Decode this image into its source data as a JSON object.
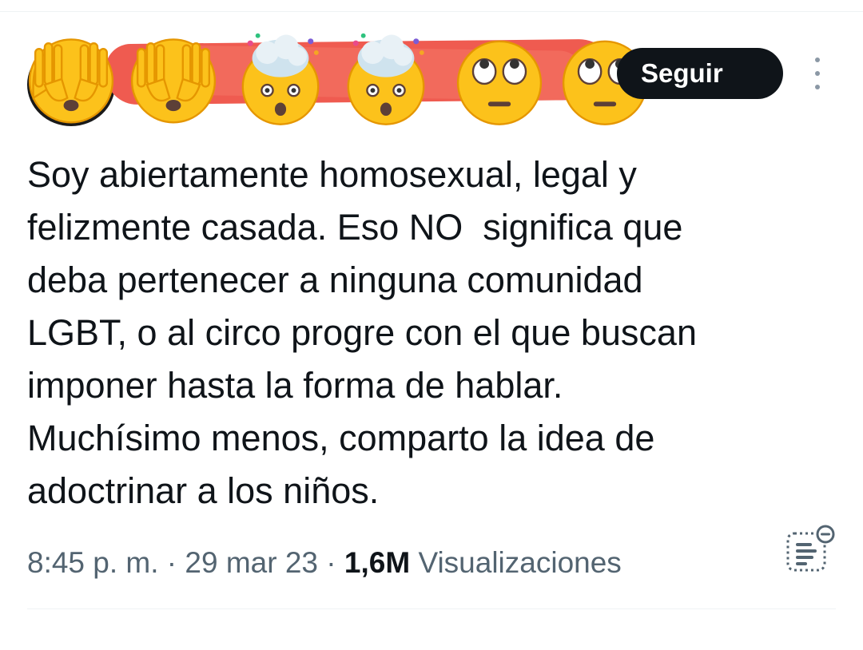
{
  "follow_button": {
    "label": "Seguir"
  },
  "tweet": {
    "text": "Soy abiertamente homosexual, legal y\nfelizmente casada. Eso NO  significa que\ndeba pertenecer a ninguna comunidad\nLGBT, o al circo progre con el que buscan\nimponer hasta la forma de hablar.\nMuchísimo menos, comparto la idea de\nadoctrinar a los niños.",
    "time": "8:45 p. m.",
    "separator": " · ",
    "date": "29 mar 23",
    "views_count": "1,6M",
    "views_label": " Visualizaciones"
  },
  "icons": {
    "censor_emojis": [
      "face-with-open-eyes-and-hand-over-mouth",
      "face-with-open-eyes-and-hand-over-mouth",
      "exploding-head",
      "exploding-head",
      "face-with-rolling-eyes",
      "face-with-rolling-eyes"
    ],
    "more": "more-vertical-icon",
    "notes": "community-notes-icon"
  },
  "colors": {
    "censor": "#ef5b50",
    "button_bg": "#0f1419",
    "text": "#0f1419",
    "secondary_text": "#536471",
    "emoji_yellow": "#fcc21b"
  }
}
